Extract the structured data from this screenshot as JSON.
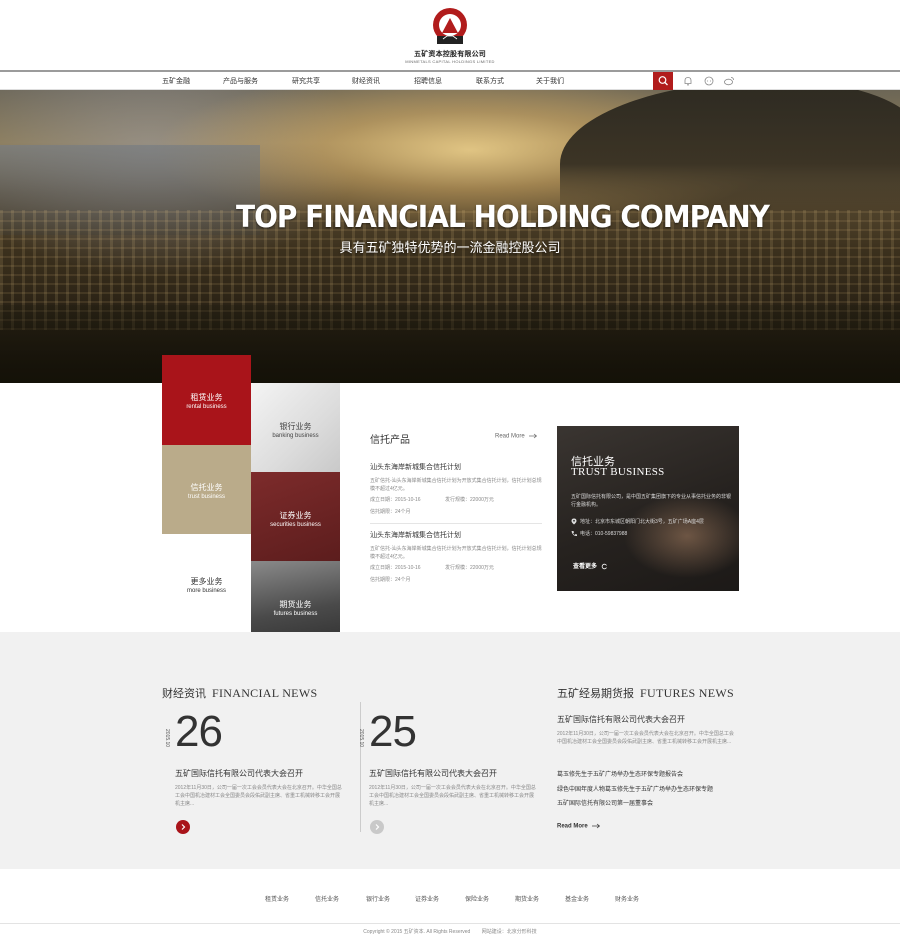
{
  "brand": {
    "arc_text": "WMINMETALS",
    "badge_text": "Y GROUP Y",
    "name_cn": "五矿资本控股有限公司",
    "name_en": "MINMETALS CAPITAL HOLDINGS LIMITED",
    "accent_color": "#a9141a"
  },
  "nav": {
    "items": [
      "五矿金融",
      "产品与服务",
      "研究共享",
      "财经资讯",
      "招聘信息",
      "联系方式",
      "关于我们"
    ],
    "icons": [
      "search-icon",
      "bell-icon",
      "chat-icon",
      "weibo-icon"
    ]
  },
  "hero": {
    "title": "TOP FINANCIAL HOLDING COMPANY",
    "subtitle": "具有五矿独特优势的一流金融控股公司"
  },
  "business": {
    "rental": {
      "cn": "租赁业务",
      "en": "rental business"
    },
    "trust": {
      "cn": "信托业务",
      "en": "trust business"
    },
    "more": {
      "cn": "更多业务",
      "en": "more business"
    },
    "banking": {
      "cn": "银行业务",
      "en": "banking business"
    },
    "securities": {
      "cn": "证券业务",
      "en": "securities business"
    },
    "futures": {
      "cn": "期货业务",
      "en": "futures business"
    }
  },
  "trust_products": {
    "title": "信托产品",
    "read_more": "Read More",
    "items": [
      {
        "title": "汕头东海岸新城集合信托计划",
        "desc": "五矿信托-汕头东海岸新城集合信托计划为开放式集合信托计划，信托计划总规模不超过4亿元。",
        "established": "成立日期：2015-10-16",
        "scale": "发行规模：22000万元",
        "term": "信托期限：24个月"
      },
      {
        "title": "汕头东海岸新城集合信托计划",
        "desc": "五矿信托-汕头东海岸新城集合信托计划为开放式集合信托计划，信托计划总规模不超过4亿元。",
        "established": "成立日期：2015-10-16",
        "scale": "发行规模：22000万元",
        "term": "信托期限：24个月"
      }
    ]
  },
  "trust_card": {
    "cn": "信托业务",
    "en": "TRUST BUSINESS",
    "desc": "五矿国际信托有限公司，是中国五矿集团旗下的专业从事信托业务的非银行金融机构。",
    "address": "地址：北京市东城区朝阳门北大街3号，五矿广场A座4层",
    "phone": "电话：010-59837988",
    "more": "查看更多"
  },
  "financial_news": {
    "title_cn": "财经资讯",
    "title_en": "FINANCIAL NEWS",
    "items": [
      {
        "day": "26",
        "ym": "2015.10",
        "title": "五矿国际信托有限公司代表大会召开",
        "desc": "2012年11月30日，公司一届一次工会会员代表大会在北京召开。中华全国总工会中国机冶建材工会全国委员会段佑武副主席、省重工机械转移工会开展机主席..."
      },
      {
        "day": "25",
        "ym": "2015.10",
        "title": "五矿国际信托有限公司代表大会召开",
        "desc": "2012年11月30日，公司一届一次工会会员代表大会在北京召开。中华全国总工会中国机冶建材工会全国委员会段佑武副主席、省重工机械转移工会开展机主席..."
      }
    ]
  },
  "futures_news": {
    "title_cn": "五矿经易期货报",
    "title_en": "FUTURES NEWS",
    "headline": "五矿国际信托有限公司代表大会召开",
    "desc": "2012年11月30日，公司一届一次工会会员代表大会在北京召开。中华全国总工会中国机冶建材工会全国委员会段佑武副主席、省重工机械转移工会开展机主席...",
    "links": [
      "葛玉修先生于五矿广场举办生态环保专题报告会",
      "绿色中国年度人物葛玉修先生于五矿广场举办生态环保专题",
      "五矿国际信托有限公司第一届董事会"
    ],
    "read_more": "Read More"
  },
  "footer": {
    "links": [
      "租赁业务",
      "信托业务",
      "银行业务",
      "证券业务",
      "保险业务",
      "期货业务",
      "基金业务",
      "财务业务"
    ],
    "copyright": "Copyright © 2015 五矿资本. All Rights Reserved",
    "credit": "网站建设：北京分形科技"
  }
}
